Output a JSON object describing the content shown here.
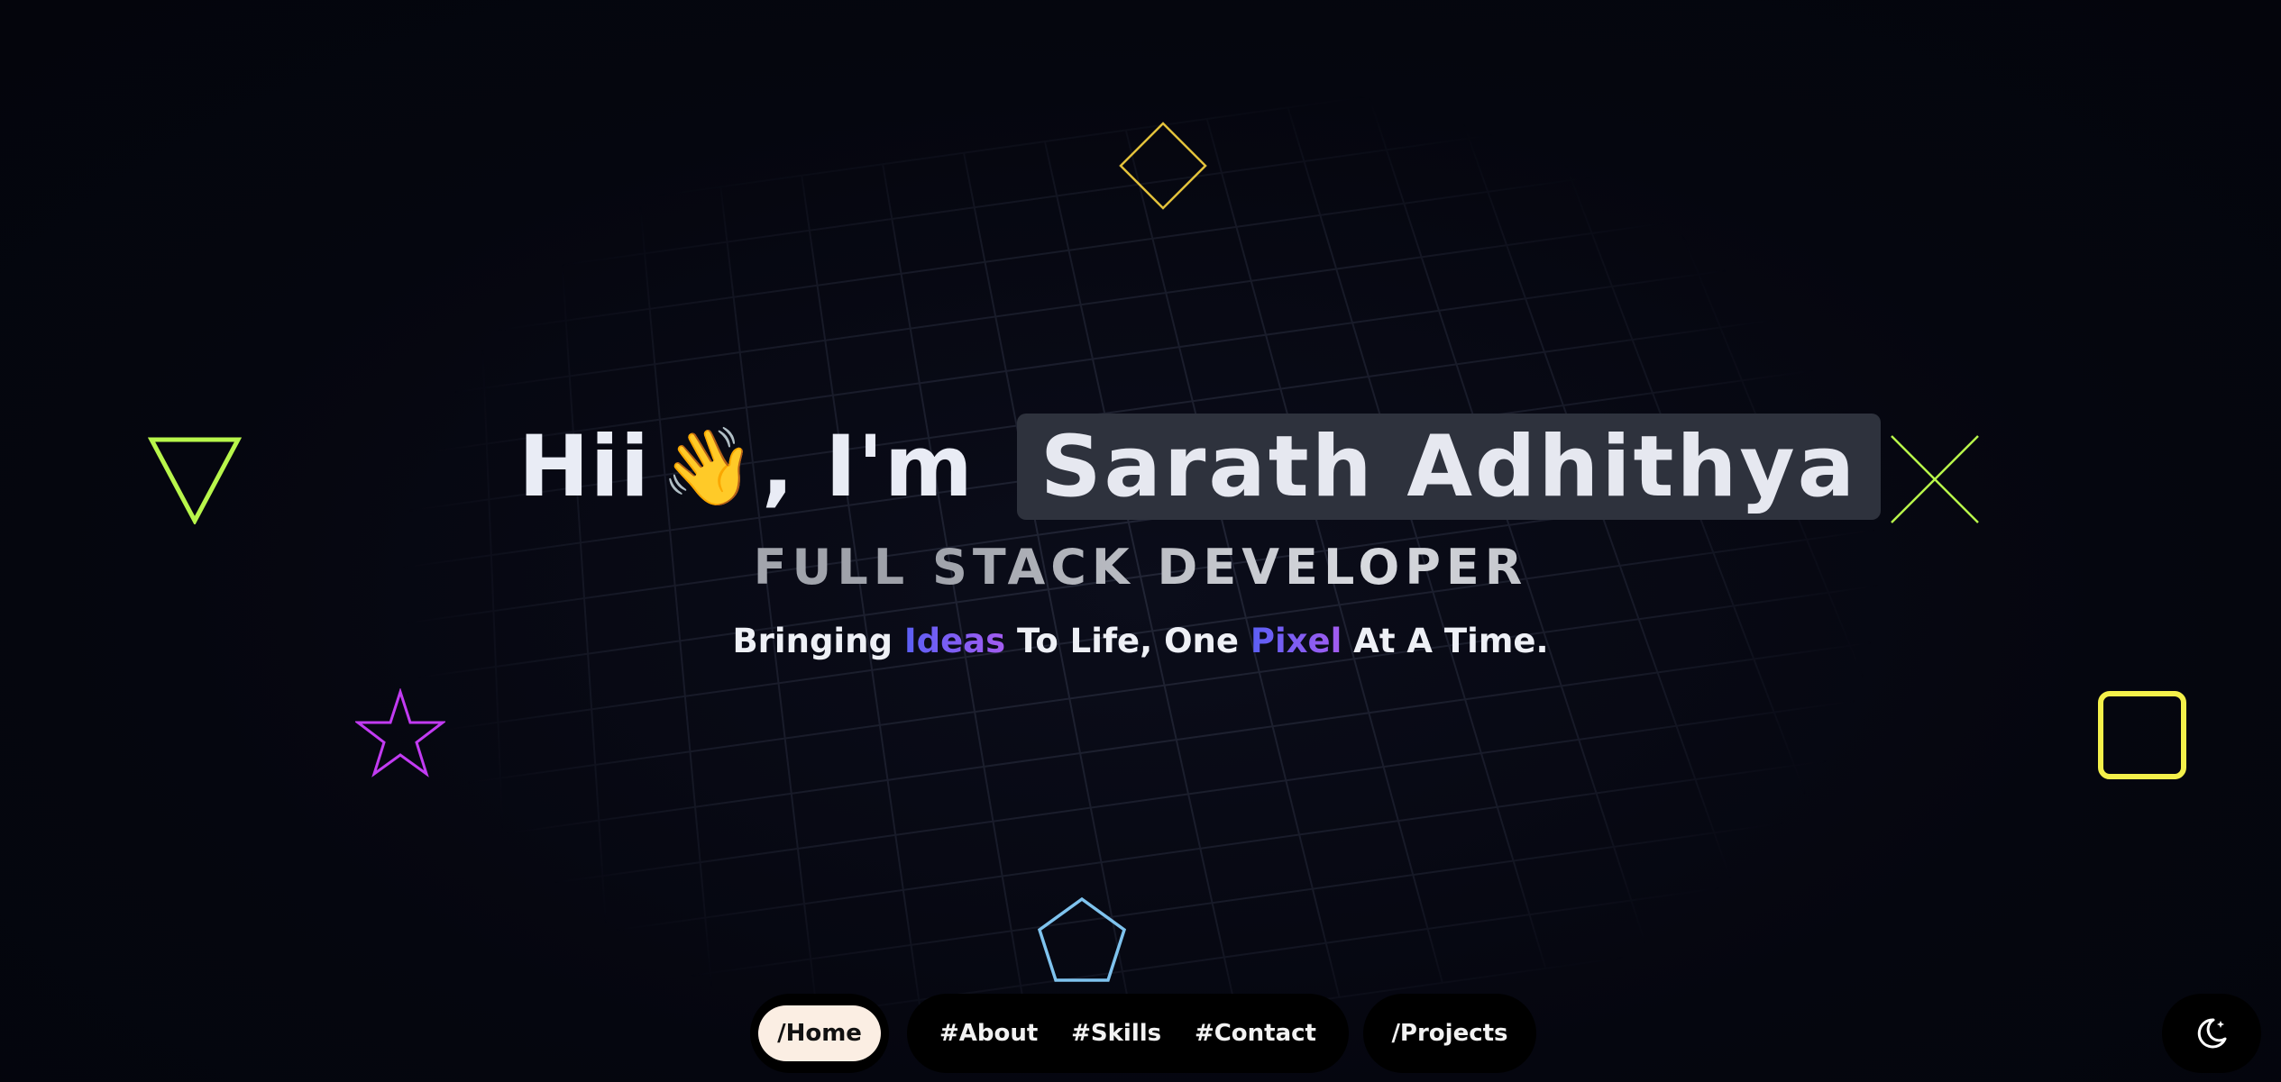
{
  "hero": {
    "greeting": "Hii",
    "wave_emoji": "👋",
    "comma_im": ", I'm",
    "name": "Sarath Adhithya",
    "role": "FULL STACK DEVELOPER",
    "tagline": {
      "part1": "Bringing ",
      "accent1": "Ideas",
      "part2": " To Life, One ",
      "accent2": "Pixel",
      "part3": " At A Time."
    }
  },
  "nav": {
    "home": "/Home",
    "about": "#About",
    "skills": "#Skills",
    "contact": "#Contact",
    "projects": "/Projects"
  },
  "theme_toggle": {
    "icon": "moon-icon"
  },
  "decorations": {
    "diamond": {
      "icon": "diamond-outline-icon",
      "color": "#e3c23b"
    },
    "triangle": {
      "icon": "triangle-down-outline-icon",
      "color": "#b8f64b"
    },
    "cross": {
      "icon": "x-cross-icon",
      "color": "#b8f64b"
    },
    "star": {
      "icon": "star-outline-icon",
      "color": "#c23bf2"
    },
    "square": {
      "icon": "rounded-square-outline-icon",
      "color": "#f4f04a"
    },
    "pentagon": {
      "icon": "pentagon-outline-icon",
      "color": "#7fc3ee"
    }
  },
  "colors": {
    "background": "#05060f",
    "name_highlight": "#2e323d",
    "accent_start": "#5b5ff5",
    "accent_end": "#a35cf0",
    "nav_active_bg": "#fbeee3"
  }
}
